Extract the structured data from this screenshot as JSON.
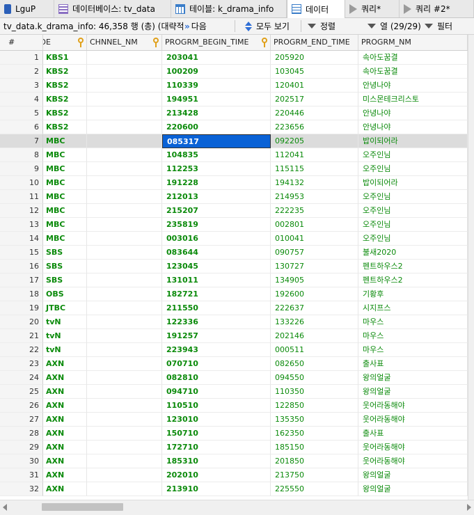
{
  "tabs": [
    {
      "label": "LguP",
      "icon": "database-icon"
    },
    {
      "label": "데이터베이스: tv_data",
      "icon": "database-lines-icon"
    },
    {
      "label": "테이블: k_drama_info",
      "icon": "table-icon"
    },
    {
      "label": "데이터",
      "icon": "grid-icon"
    },
    {
      "label": "쿼리*",
      "icon": "play-icon"
    },
    {
      "label": "쿼리 #2*",
      "icon": "play-icon"
    }
  ],
  "toolbar": {
    "info": "tv_data.k_drama_info: 46,358 행 (총) (대략적), 제",
    "next": "다음",
    "show_all": "모두 보기",
    "sort": "정렬",
    "columns": "열 (29/29)",
    "filter": "필터"
  },
  "columns": {
    "rownum": "#",
    "partial": "_DE",
    "chnnel": "CHNNEL_NM",
    "begin": "PROGRM_BEGIN_TIME",
    "end": "PROGRM_END_TIME",
    "name": "PROGRM_NM"
  },
  "selected_row": 7,
  "rows": [
    {
      "n": "1",
      "ch": "KBS1",
      "bt": "203041",
      "et": "205920",
      "nm": "속아도꿈결"
    },
    {
      "n": "2",
      "ch": "KBS2",
      "bt": "100209",
      "et": "103045",
      "nm": "속아도꿈결"
    },
    {
      "n": "3",
      "ch": "KBS2",
      "bt": "110339",
      "et": "120401",
      "nm": "안녕나야"
    },
    {
      "n": "4",
      "ch": "KBS2",
      "bt": "194951",
      "et": "202517",
      "nm": "미스몬테크리스토"
    },
    {
      "n": "5",
      "ch": "KBS2",
      "bt": "213428",
      "et": "220446",
      "nm": "안녕나야"
    },
    {
      "n": "6",
      "ch": "KBS2",
      "bt": "220600",
      "et": "223656",
      "nm": "안녕나야"
    },
    {
      "n": "7",
      "ch": "MBC",
      "bt": "085317",
      "et": "092205",
      "nm": "밥이되어라"
    },
    {
      "n": "8",
      "ch": "MBC",
      "bt": "104835",
      "et": "112041",
      "nm": "오주인님"
    },
    {
      "n": "9",
      "ch": "MBC",
      "bt": "112253",
      "et": "115115",
      "nm": "오주인님"
    },
    {
      "n": "10",
      "ch": "MBC",
      "bt": "191228",
      "et": "194132",
      "nm": "밥이되어라"
    },
    {
      "n": "11",
      "ch": "MBC",
      "bt": "212013",
      "et": "214953",
      "nm": "오주인님"
    },
    {
      "n": "12",
      "ch": "MBC",
      "bt": "215207",
      "et": "222235",
      "nm": "오주인님"
    },
    {
      "n": "13",
      "ch": "MBC",
      "bt": "235819",
      "et": "002801",
      "nm": "오주인님"
    },
    {
      "n": "14",
      "ch": "MBC",
      "bt": "003016",
      "et": "010041",
      "nm": "오주인님"
    },
    {
      "n": "15",
      "ch": "SBS",
      "bt": "083644",
      "et": "090757",
      "nm": "불새2020"
    },
    {
      "n": "16",
      "ch": "SBS",
      "bt": "123045",
      "et": "130727",
      "nm": "펜트하우스2"
    },
    {
      "n": "17",
      "ch": "SBS",
      "bt": "131011",
      "et": "134905",
      "nm": "펜트하우스2"
    },
    {
      "n": "18",
      "ch": "OBS",
      "bt": "182721",
      "et": "192600",
      "nm": "기황후"
    },
    {
      "n": "19",
      "ch": "JTBC",
      "bt": "211550",
      "et": "222637",
      "nm": "시지프스"
    },
    {
      "n": "20",
      "ch": "tvN",
      "bt": "122336",
      "et": "133226",
      "nm": "마우스"
    },
    {
      "n": "21",
      "ch": "tvN",
      "bt": "191257",
      "et": "202146",
      "nm": "마우스"
    },
    {
      "n": "22",
      "ch": "tvN",
      "bt": "223943",
      "et": "000511",
      "nm": "마우스"
    },
    {
      "n": "23",
      "ch": "AXN",
      "bt": "070710",
      "et": "082650",
      "nm": "출사표"
    },
    {
      "n": "24",
      "ch": "AXN",
      "bt": "082810",
      "et": "094550",
      "nm": "왕의얼굴"
    },
    {
      "n": "25",
      "ch": "AXN",
      "bt": "094710",
      "et": "110350",
      "nm": "왕의얼굴"
    },
    {
      "n": "26",
      "ch": "AXN",
      "bt": "110510",
      "et": "122850",
      "nm": "웃어라동해야"
    },
    {
      "n": "27",
      "ch": "AXN",
      "bt": "123010",
      "et": "135350",
      "nm": "웃어라동해야"
    },
    {
      "n": "28",
      "ch": "AXN",
      "bt": "150710",
      "et": "162350",
      "nm": "출사표"
    },
    {
      "n": "29",
      "ch": "AXN",
      "bt": "172710",
      "et": "185150",
      "nm": "웃어라동해야"
    },
    {
      "n": "30",
      "ch": "AXN",
      "bt": "185310",
      "et": "201850",
      "nm": "웃어라동해야"
    },
    {
      "n": "31",
      "ch": "AXN",
      "bt": "202010",
      "et": "213750",
      "nm": "왕의얼굴"
    },
    {
      "n": "32",
      "ch": "AXN",
      "bt": "213910",
      "et": "225550",
      "nm": "왕의얼굴"
    }
  ]
}
